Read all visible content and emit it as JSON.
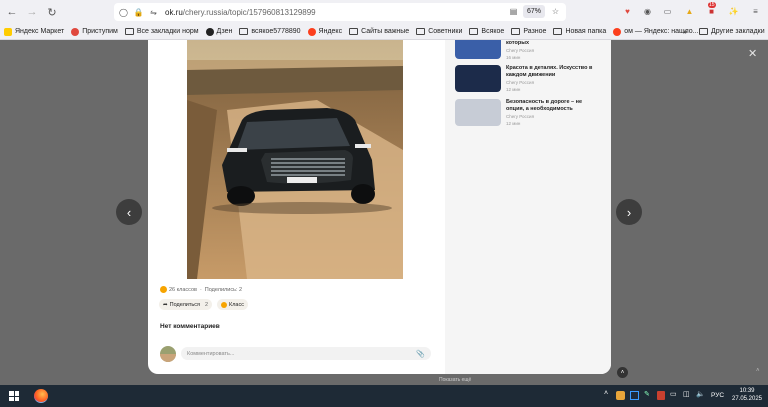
{
  "browser": {
    "url_main": "ok.ru",
    "url_path": "/chery.russia/topic/157960813129899",
    "zoom": "67%",
    "ext_badge": "15"
  },
  "bookmarks": [
    {
      "label": "Яндекс Маркет",
      "icon": "yandex-market-icon",
      "color": "#ffcc00"
    },
    {
      "label": "Приступим",
      "icon": "prist-icon",
      "color": "#e0483e"
    },
    {
      "label": "Все закладки норм",
      "icon": "folder-icon",
      "color": ""
    },
    {
      "label": "Дзен",
      "icon": "dzen-icon",
      "color": "#222222"
    },
    {
      "label": "всякое5778890",
      "icon": "folder-icon",
      "color": ""
    },
    {
      "label": "Яндекс",
      "icon": "yandex-icon",
      "color": "#fc3f1d"
    },
    {
      "label": "Сайты важные",
      "icon": "folder-icon",
      "color": ""
    },
    {
      "label": "Советники",
      "icon": "folder-icon",
      "color": ""
    },
    {
      "label": "Всякое",
      "icon": "folder-icon",
      "color": ""
    },
    {
      "label": "Разное",
      "icon": "folder-icon",
      "color": ""
    },
    {
      "label": "Новая папка",
      "icon": "folder-icon",
      "color": ""
    },
    {
      "label": "ом — Яндекс: нашло...",
      "icon": "yandex-icon",
      "color": "#fc3f1d"
    }
  ],
  "other_bookmarks": "Другие закладки",
  "post": {
    "likes_text": "26 классов",
    "shares_text": "Поделились: 2",
    "share_button": "Поделиться",
    "share_count": "2",
    "like_button": "Класс",
    "no_comments": "Нет комментариев",
    "comment_placeholder": "Комментировать..."
  },
  "related": [
    {
      "title": "которых",
      "source": "Chery Россия",
      "time": "16 мин",
      "thumb_color": "#3a5fa8"
    },
    {
      "title": "Красота в деталях. Искусство в каждом движении",
      "source": "Chery Россия",
      "time": "12 мин",
      "thumb_color": "#1c2b4a"
    },
    {
      "title": "Безопасность в дороге – не опция, а необходимость",
      "source": "Chery Россия",
      "time": "12 мин",
      "thumb_color": "#c7ccd6"
    }
  ],
  "footer_hint": "Показать ещё",
  "taskbar": {
    "lang": "РУС",
    "time": "10:39",
    "date": "27.05.2025"
  }
}
